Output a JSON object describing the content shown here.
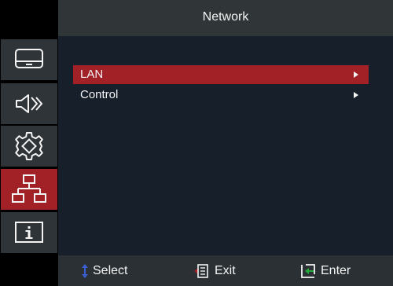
{
  "header": {
    "title": "Network"
  },
  "sidebar": {
    "tabs": [
      {
        "icon": "display-icon",
        "active": false
      },
      {
        "icon": "audio-icon",
        "active": false
      },
      {
        "icon": "settings-gear-icon",
        "active": false
      },
      {
        "icon": "network-icon",
        "active": true
      },
      {
        "icon": "info-icon",
        "active": false
      }
    ]
  },
  "menu": {
    "items": [
      {
        "label": "LAN",
        "selected": true
      },
      {
        "label": "Control",
        "selected": false
      }
    ]
  },
  "footer": {
    "select_label": "Select",
    "exit_label": "Exit",
    "enter_label": "Enter"
  },
  "colors": {
    "accent_red": "#a12127",
    "background": "#17202a",
    "header_bg": "#303538",
    "footer_bg": "#2a3034",
    "select_icon_blue": "#3a5fd0",
    "enter_icon_green": "#24a83a"
  }
}
